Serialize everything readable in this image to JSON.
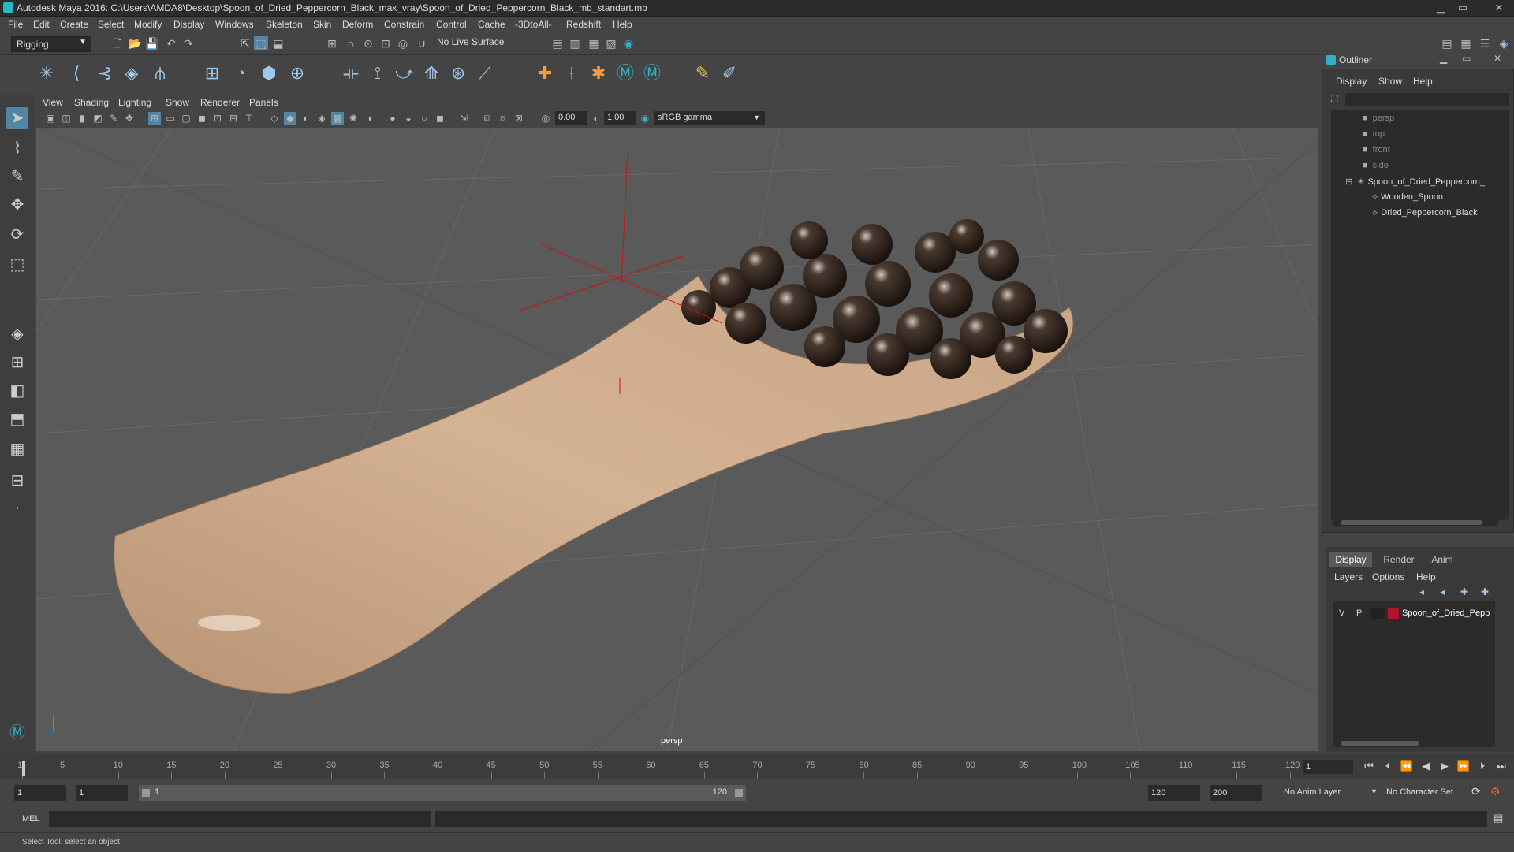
{
  "window": {
    "title": "Autodesk Maya 2016: C:\\Users\\AMDA8\\Desktop\\Spoon_of_Dried_Peppercorn_Black_max_vray\\Spoon_of_Dried_Peppercorn_Black_mb_standart.mb",
    "minimize": "▁",
    "maximize": "▭",
    "close": "✕"
  },
  "menubar": {
    "items": [
      "File",
      "Edit",
      "Create",
      "Select",
      "Modify",
      "Display",
      "Windows",
      "Skeleton",
      "Skin",
      "Deform",
      "Constrain",
      "Control",
      "Cache",
      "-3DtoAll-",
      "Redshift",
      "Help"
    ]
  },
  "status": {
    "mode": "Rigging",
    "live_surface": "No Live Surface"
  },
  "viewport": {
    "menu": [
      "View",
      "Shading",
      "Lighting",
      "Show",
      "Renderer",
      "Panels"
    ],
    "exposure": "0.00",
    "gamma_value": "1.00",
    "color_space": "sRGB gamma",
    "camera": "persp"
  },
  "outliner": {
    "title": "Outliner",
    "menu": [
      "Display",
      "Show",
      "Help"
    ],
    "cameras": [
      "persp",
      "top",
      "front",
      "side"
    ],
    "group": "Spoon_of_Dried_Peppercorn_",
    "children": [
      "Wooden_Spoon",
      "Dried_Peppercorn_Black"
    ]
  },
  "layers": {
    "tabs": [
      "Display",
      "Render",
      "Anim"
    ],
    "active_tab": "Display",
    "menu": [
      "Layers",
      "Options",
      "Help"
    ],
    "row": {
      "v": "V",
      "p": "P",
      "name": "Spoon_of_Dried_Pepp",
      "color": "#b0132a"
    }
  },
  "timeline": {
    "ticks": [
      "1",
      "5",
      "10",
      "15",
      "20",
      "25",
      "30",
      "35",
      "40",
      "45",
      "50",
      "55",
      "60",
      "65",
      "70",
      "75",
      "80",
      "85",
      "90",
      "95",
      "100",
      "105",
      "110",
      "115",
      "120"
    ],
    "current_frame": "1"
  },
  "range": {
    "start": "1",
    "playback_start": "1",
    "slider_start": "1",
    "slider_end": "120",
    "playback_end": "120",
    "end": "200",
    "anim_layer": "No Anim Layer",
    "char_set": "No Character Set"
  },
  "command": {
    "lang": "MEL"
  },
  "help": {
    "text": "Select Tool: select an object"
  }
}
